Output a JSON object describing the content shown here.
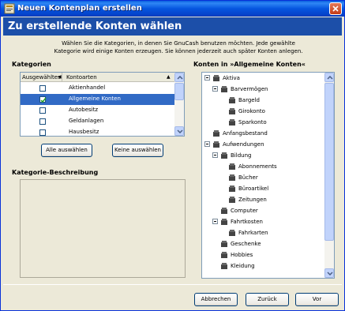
{
  "window": {
    "title": "Neuen Kontenplan erstellen"
  },
  "banner": {
    "title": "Zu erstellende Konten wählen"
  },
  "intro": {
    "line1": "Wählen Sie die Kategorien, in denen Sie GnuCash benutzen möchten. Jede gewählte",
    "line2": "Kategorie wird einige Konten erzeugen. Sie können jederzeit auch später Konten anlegen."
  },
  "categories": {
    "label": "Kategorien",
    "header_selected": "Ausgewähltes",
    "header_type": "Kontoarten",
    "rows": [
      {
        "name": "Aktienhandel",
        "checked": false
      },
      {
        "name": "Allgemeine Konten",
        "checked": true
      },
      {
        "name": "Autobesitz",
        "checked": false
      },
      {
        "name": "Geldanlagen",
        "checked": false
      },
      {
        "name": "Hausbesitz",
        "checked": false
      }
    ]
  },
  "buttons": {
    "select_all": "Alle auswählen",
    "select_none": "Keine auswählen",
    "cancel": "Abbrechen",
    "back": "Zurück",
    "next": "Vor"
  },
  "description": {
    "label": "Kategorie-Beschreibung"
  },
  "accounts": {
    "label": "Konten in »Allgemeine Konten«",
    "tree": [
      {
        "name": "Aktiva",
        "expandable": true
      },
      {
        "name": "Barvermögen",
        "expandable": true
      },
      {
        "name": "Bargeld",
        "expandable": false
      },
      {
        "name": "Girokonto",
        "expandable": false
      },
      {
        "name": "Sparkonto",
        "expandable": false
      },
      {
        "name": "Anfangsbestand",
        "expandable": false
      },
      {
        "name": "Aufwendungen",
        "expandable": true
      },
      {
        "name": "Bildung",
        "expandable": true
      },
      {
        "name": "Abonnements",
        "expandable": false
      },
      {
        "name": "Bücher",
        "expandable": false
      },
      {
        "name": "Büroartikel",
        "expandable": false
      },
      {
        "name": "Zeitungen",
        "expandable": false
      },
      {
        "name": "Computer",
        "expandable": false
      },
      {
        "name": "Fahrtkosten",
        "expandable": true
      },
      {
        "name": "Fahrkarten",
        "expandable": false
      },
      {
        "name": "Geschenke",
        "expandable": false
      },
      {
        "name": "Hobbies",
        "expandable": false
      },
      {
        "name": "Kleidung",
        "expandable": false
      }
    ]
  },
  "colors": {
    "banner": "#1c4fa9",
    "selection": "#316ac5",
    "titlebar": "#0555df"
  }
}
